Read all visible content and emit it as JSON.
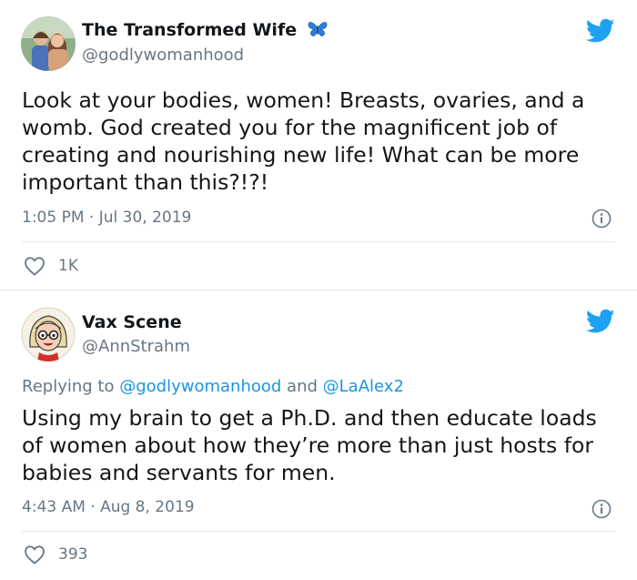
{
  "tweets": [
    {
      "name": "The Transformed Wife",
      "handle": "@godlywomanhood",
      "text": "Look at your bodies, women! Breasts, ovaries, and a womb. God created you for the magnificent job of creating and nourishing new life! What can be more important than this?!?!",
      "timestamp": "1:05 PM · Jul 30, 2019",
      "likes": "1K",
      "name_emoji": "butterfly-icon"
    },
    {
      "name": "Vax Scene",
      "handle": "@AnnStrahm",
      "replying_prefix": "Replying to",
      "replying_mention_1": "@godlywomanhood",
      "replying_and": "and",
      "replying_mention_2": "@LaAlex2",
      "text": "Using my brain to get a Ph.D. and then educate loads of women about how they’re more than just hosts for babies and servants for men.",
      "timestamp": "4:43 AM · Aug 8, 2019",
      "likes": "393"
    }
  ],
  "colors": {
    "twitter_blue": "#1da1f2",
    "text_primary": "#14171a",
    "text_secondary": "#657786",
    "divider": "#e1e8ed",
    "mention": "#1b95e0"
  }
}
